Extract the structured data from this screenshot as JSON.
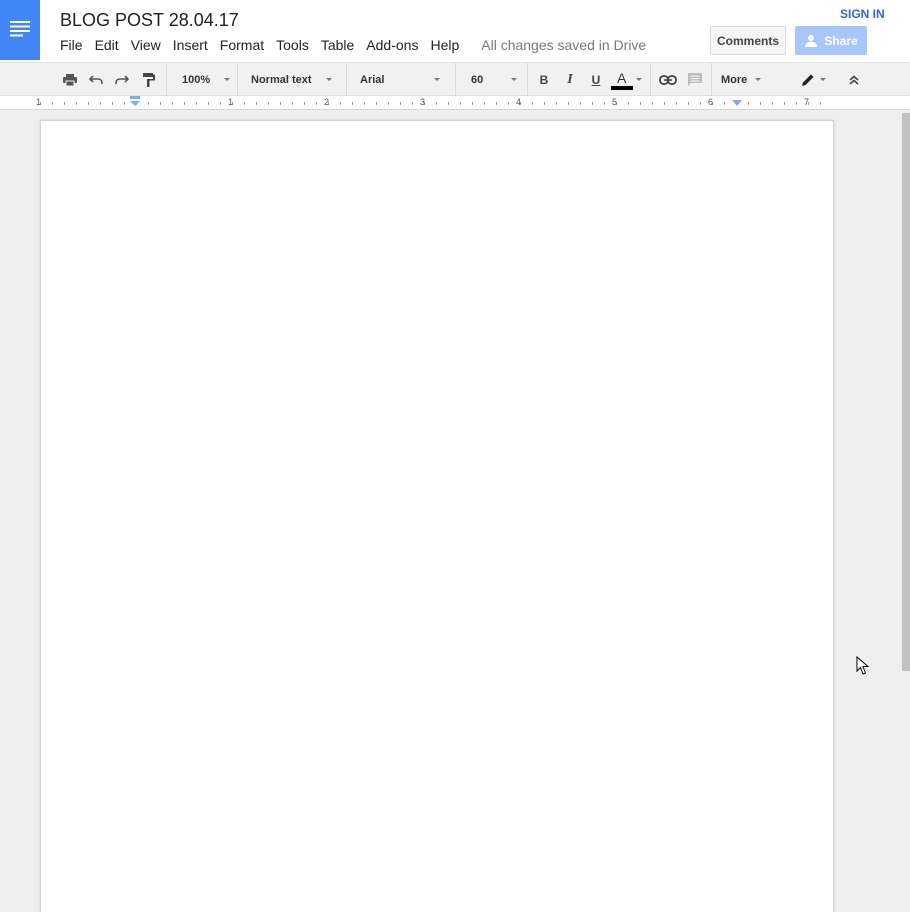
{
  "document": {
    "title": "BLOG POST 28.04.17",
    "save_status": "All changes saved in Drive"
  },
  "menu": [
    {
      "label": "File"
    },
    {
      "label": "Edit"
    },
    {
      "label": "View"
    },
    {
      "label": "Insert"
    },
    {
      "label": "Format"
    },
    {
      "label": "Tools"
    },
    {
      "label": "Table"
    },
    {
      "label": "Add-ons"
    },
    {
      "label": "Help"
    }
  ],
  "header": {
    "sign_in_label": "SIGN IN",
    "comments_label": "Comments",
    "share_label": "Share"
  },
  "toolbar": {
    "zoom": "100%",
    "style": "Normal text",
    "font": "Arial",
    "font_size": "60",
    "bold_label": "B",
    "italic_label": "I",
    "underline_label": "U",
    "text_color_label": "A",
    "more_label": "More",
    "text_color": "#000000"
  },
  "ruler": {
    "numbers": [
      "1",
      "1",
      "2",
      "3",
      "4",
      "5",
      "6",
      "7"
    ]
  },
  "colors": {
    "brand": "#4285f4",
    "link": "#3367d6",
    "share_disabled": "#a8c6fa"
  }
}
